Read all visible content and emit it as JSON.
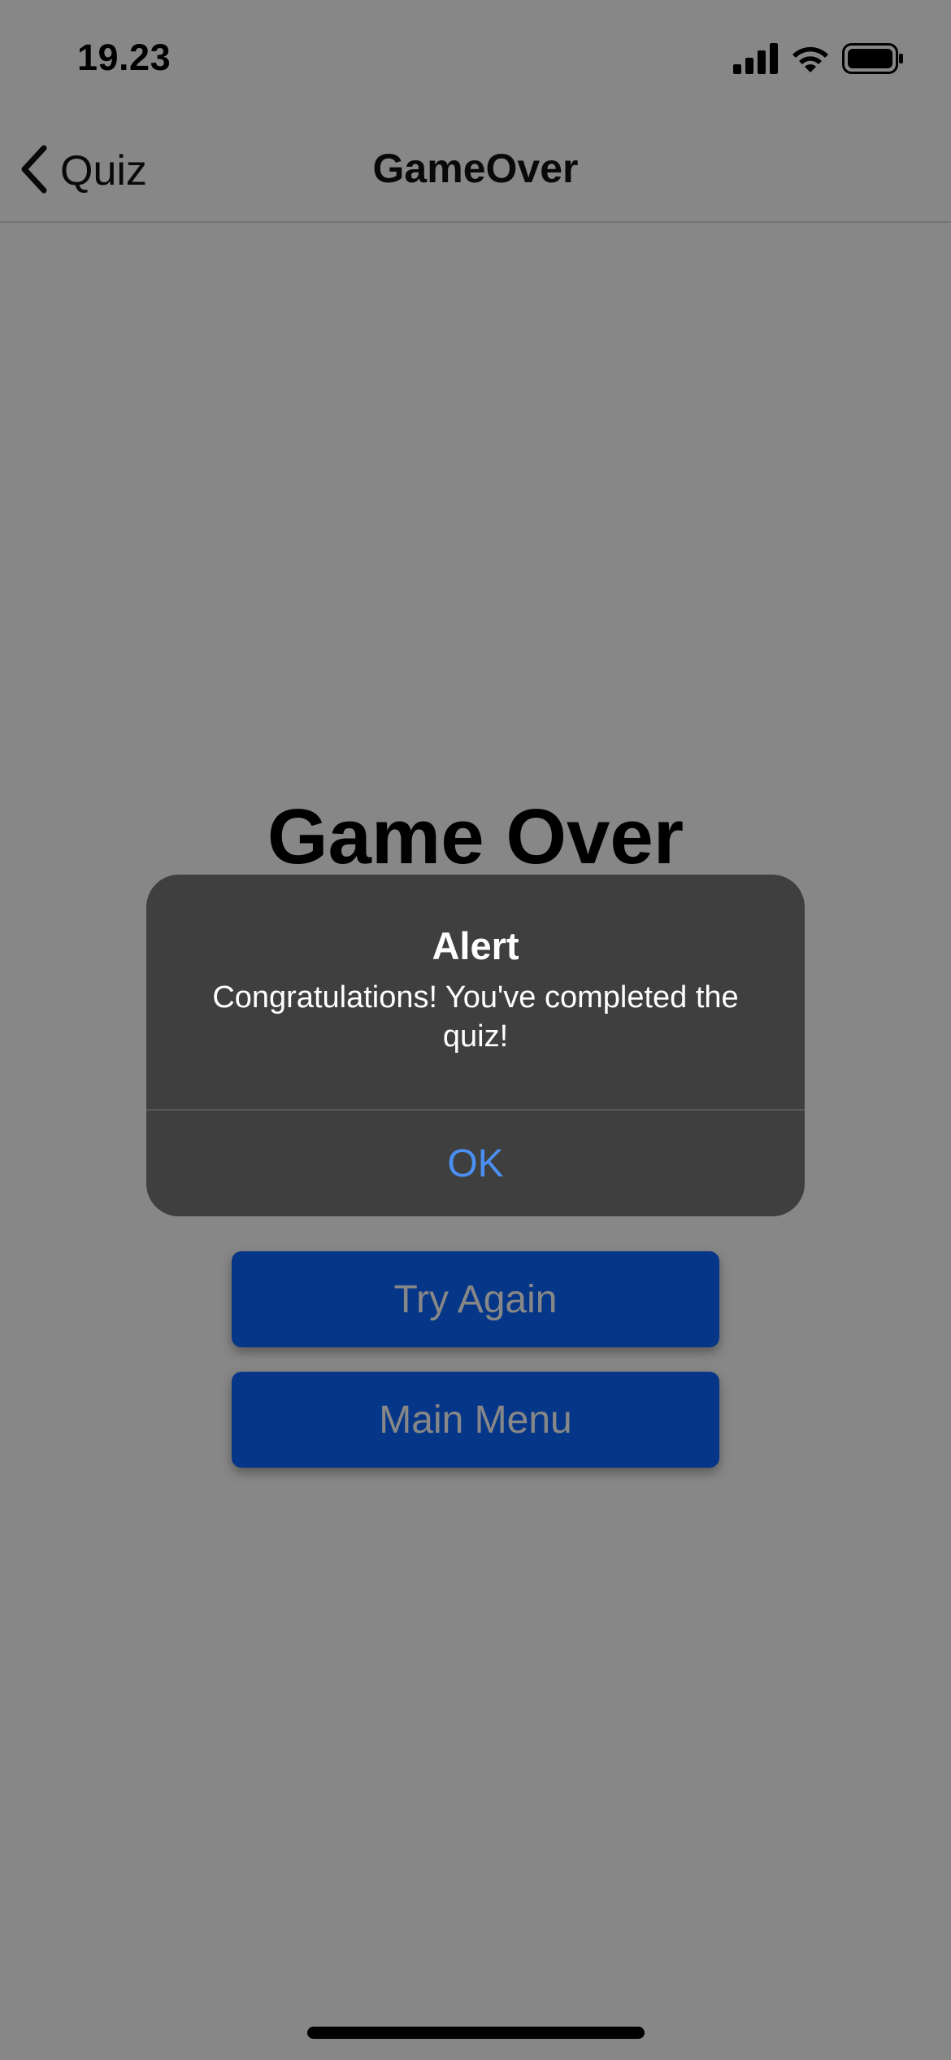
{
  "status_bar": {
    "time": "19.23",
    "icons": [
      "signal-icon",
      "wifi-icon",
      "battery-icon"
    ]
  },
  "nav": {
    "back_label": "Quiz",
    "title": "GameOver"
  },
  "content": {
    "heading": "Game Over",
    "score_text": "",
    "buttons": {
      "try_again": "Try Again",
      "main_menu": "Main Menu"
    }
  },
  "alert": {
    "title": "Alert",
    "message": "Congratulations! You've completed the quiz!",
    "ok_label": "OK"
  },
  "colors": {
    "accent_button": "#0a66ff",
    "alert_background": "#3f3f3f",
    "alert_action": "#4a8ff2"
  }
}
